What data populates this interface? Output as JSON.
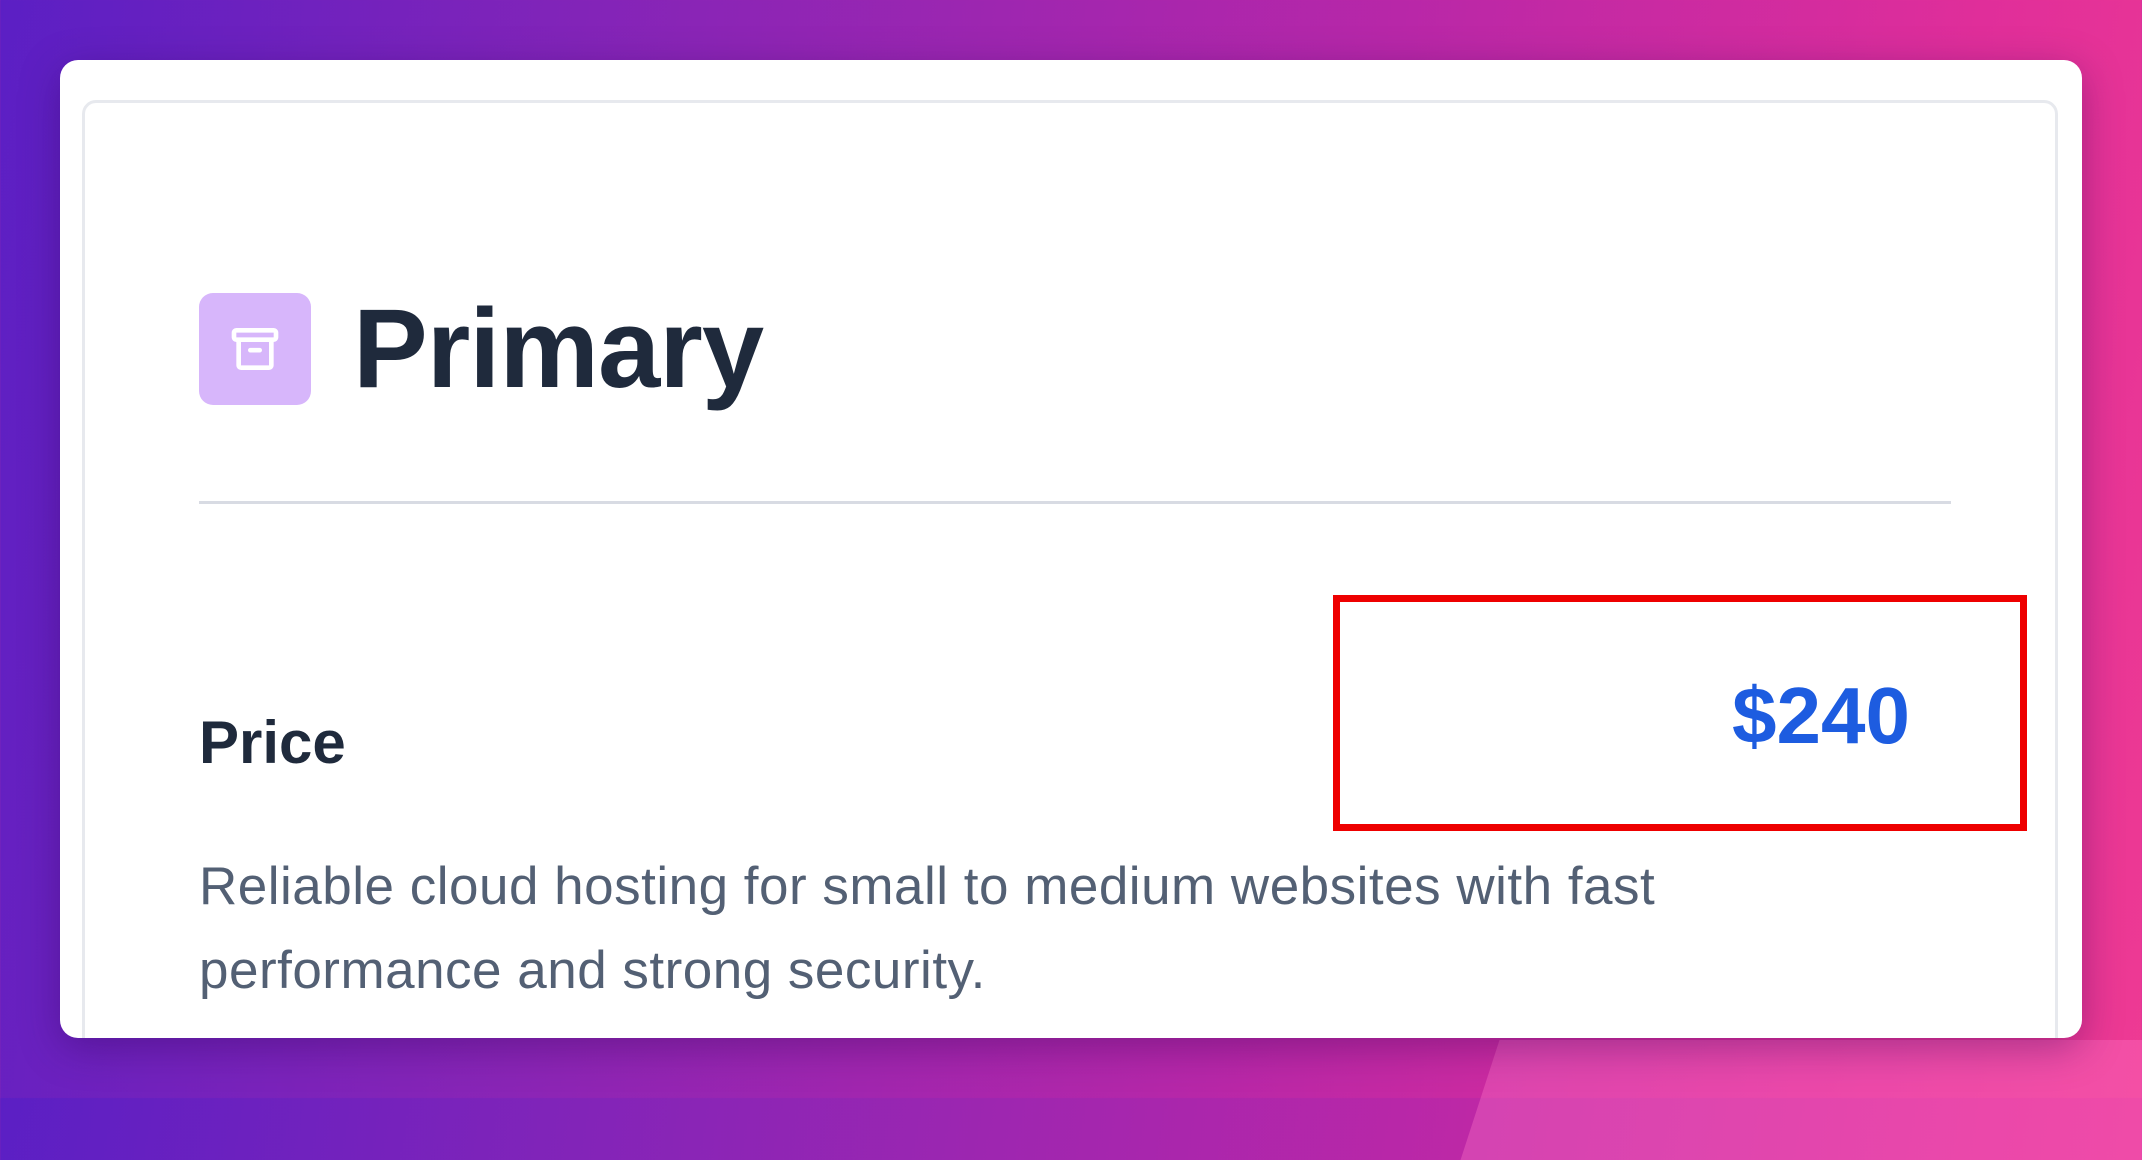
{
  "card": {
    "icon": "archive-box-icon",
    "icon_bg_color": "#d7b6fb",
    "title": "Primary",
    "price_label": "Price",
    "price_value": "$240",
    "price_color": "#1d5ce0",
    "description": "Reliable cloud hosting for small to medium websites with fast performance and strong security."
  },
  "highlight_color": "#ee0000"
}
